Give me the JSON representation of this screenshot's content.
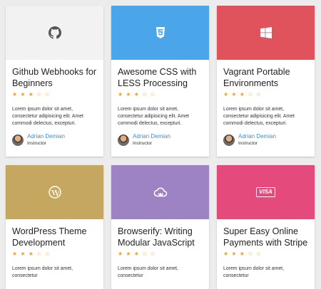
{
  "colors": {
    "github": "#f2f2f2",
    "css": "#4aa6e8",
    "vagrant": "#e0525c",
    "wordpress": "#c6a760",
    "browserify": "#9e83c4",
    "stripe": "#e54a7c",
    "star": "#f0a31c",
    "instructor_link": "#3a8fd6"
  },
  "cards": [
    {
      "title": "Github Webhooks for Beginners",
      "icon": "github-icon",
      "rating": 3,
      "stars": "★ ★ ★ ☆ ☆",
      "description": "Lorem ipsum dolor sit amet, consectetur adipisicing elit. Amet commodi delectus, excepturi.",
      "instructor": {
        "name": "Adrian Demian",
        "role": "Instructor"
      }
    },
    {
      "title": "Awesome CSS with LESS Processing",
      "icon": "css3-icon",
      "rating": 3,
      "stars": "★ ★ ★ ☆ ☆",
      "description": "Lorem ipsum dolor sit amet, consectetur adipisicing elit. Amet commodi delectus, excepturi.",
      "instructor": {
        "name": "Adrian Demian",
        "role": "Instructor"
      }
    },
    {
      "title": "Vagrant Portable Environments",
      "icon": "windows-icon",
      "rating": 3,
      "stars": "★ ★ ★ ☆ ☆",
      "description": "Lorem ipsum dolor sit amet, consectetur adipisicing elit. Amet commodi delectus, excepturi.",
      "instructor": {
        "name": "Adrian Demian",
        "role": "Instructor"
      }
    },
    {
      "title": "WordPress Theme Development",
      "icon": "wordpress-icon",
      "rating": 3,
      "stars": "★ ★ ★ ☆ ☆",
      "description": "Lorem ipsum dolor sit amet, consectetur"
    },
    {
      "title": "Browserify: Writing Modular JavaScript",
      "icon": "cloud-icon",
      "rating": 3,
      "stars": "★ ★ ★ ☆ ☆",
      "description": "Lorem ipsum dolor sit amet, consectetur"
    },
    {
      "title": "Super Easy Online Payments with Stripe",
      "icon": "visa-icon",
      "visa_text": "VISA",
      "rating": 3,
      "stars": "★ ★ ★ ☆ ☆",
      "description": "Lorem ipsum dolor sit amet, consectetur"
    }
  ]
}
